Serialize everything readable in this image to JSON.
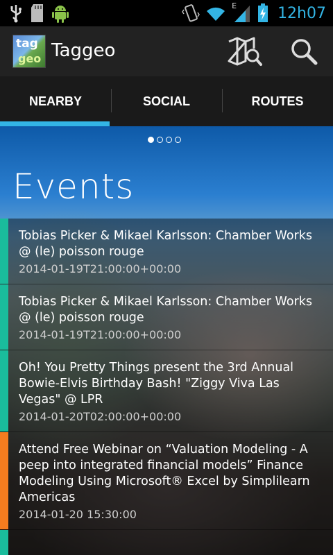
{
  "status_bar": {
    "time": "12h07",
    "network_label": "E",
    "icons": [
      "usb-icon",
      "sd-card-icon",
      "android-icon",
      "vibrate-icon",
      "wifi-icon",
      "signal-icon",
      "battery-charging-icon"
    ]
  },
  "action_bar": {
    "logo_text_top": "tag",
    "logo_text_bottom": "geo",
    "title": "Taggeo",
    "actions": [
      "map-search-icon",
      "search-icon"
    ]
  },
  "tabs": [
    {
      "label": "NEARBY",
      "selected": true
    },
    {
      "label": "SOCIAL",
      "selected": false
    },
    {
      "label": "ROUTES",
      "selected": false
    }
  ],
  "pager": {
    "count": 4,
    "active_index": 0
  },
  "section_title": "Events",
  "events": [
    {
      "title": "Tobias Picker & Mikael Karlsson: Chamber Works @ (le) poisson rouge",
      "date": "2014-01-19T21:00:00+00:00",
      "color": "#1abc9c"
    },
    {
      "title": "Tobias Picker & Mikael Karlsson: Chamber Works @ (le) poisson rouge",
      "date": "2014-01-19T21:00:00+00:00",
      "color": "#1abc9c"
    },
    {
      "title": "Oh! You Pretty Things present the 3rd Annual Bowie-Elvis Birthday Bash! \"Ziggy Viva Las Vegas\"  @ LPR",
      "date": "2014-01-20T02:00:00+00:00",
      "color": "#1abc9c"
    },
    {
      "title": "Attend Free Webinar on “Valuation Modeling - A peep into integrated financial models” Finance Modeling Using Microsoft® Excel by Simplilearn Americas",
      "date": "2014-01-20 15:30:00",
      "color": "#f57c1f"
    }
  ],
  "colors": {
    "accent": "#33b5e5",
    "teal_strip": "#1abc9c",
    "orange_strip": "#f57c1f"
  }
}
